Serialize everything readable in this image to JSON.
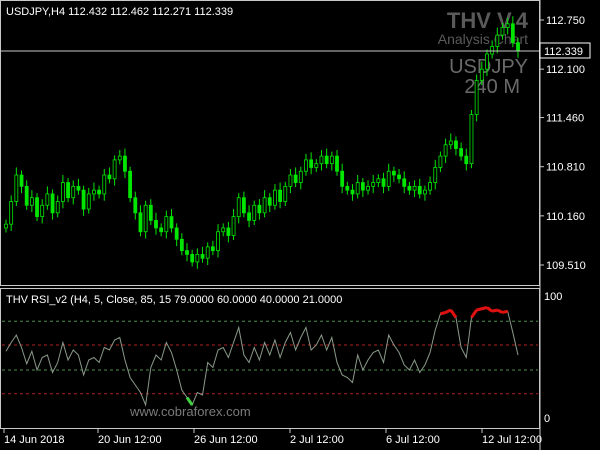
{
  "main_chart": {
    "symbol_info": "USDJPY,H4  112.432 112.462 112.271 112.339",
    "watermark_title": "THV V.4",
    "watermark_subtitle": "Analysis Chart",
    "watermark_symbol": "USDJPY",
    "watermark_timeframe": "240 M",
    "current_price": "112.339",
    "price_ticks": [
      "112.750",
      "112.100",
      "111.460",
      "110.810",
      "110.160",
      "109.510"
    ]
  },
  "indicator": {
    "label": "THV RSI_v2  (H4,  5,  Close,  85,  15 79.0000 60.0000 40.0000 21.0000",
    "scale_top": "100",
    "scale_bottom": "0",
    "levels": [
      79,
      60,
      40,
      21
    ],
    "level_colors": [
      "#4e8f4e",
      "#b02020",
      "#4e8f4e",
      "#b02020"
    ]
  },
  "time_axis": [
    "14 Jun 2018",
    "20 Jun 12:00",
    "26 Jun 12:00",
    "2 Jul 12:00",
    "6 Jul 12:00",
    "12 Jul 12:00"
  ],
  "footer": {
    "watermark": "www.cobraforex.com"
  },
  "colors": {
    "candle": "#00e600",
    "rsi_line": "#8a9a8a",
    "rsi_high": "#e01010",
    "rsi_low": "#40d040",
    "grid": "#c8c8c8"
  },
  "chart_data": {
    "type": "candlestick",
    "y_range": [
      109.3,
      112.95
    ],
    "rsi_range": [
      0,
      100
    ],
    "closes": [
      110.05,
      110.35,
      110.7,
      110.55,
      110.3,
      110.4,
      110.15,
      110.3,
      110.45,
      110.2,
      110.35,
      110.6,
      110.4,
      110.55,
      110.5,
      110.25,
      110.45,
      110.5,
      110.45,
      110.7,
      110.65,
      110.9,
      110.95,
      110.75,
      110.4,
      110.2,
      109.95,
      110.3,
      110.1,
      110.0,
      109.95,
      110.15,
      110.0,
      109.85,
      109.7,
      109.65,
      109.55,
      109.65,
      109.6,
      109.75,
      109.7,
      109.95,
      110.0,
      109.9,
      110.15,
      110.4,
      110.2,
      110.1,
      110.3,
      110.2,
      110.4,
      110.3,
      110.5,
      110.35,
      110.55,
      110.7,
      110.6,
      110.75,
      110.9,
      110.8,
      110.85,
      110.95,
      110.85,
      110.95,
      110.75,
      110.55,
      110.5,
      110.45,
      110.6,
      110.5,
      110.55,
      110.6,
      110.65,
      110.55,
      110.75,
      110.7,
      110.65,
      110.55,
      110.5,
      110.55,
      110.45,
      110.5,
      110.6,
      110.8,
      110.95,
      111.1,
      111.15,
      111.05,
      110.95,
      110.85,
      111.5,
      111.95,
      112.1,
      112.3,
      112.4,
      112.55,
      112.65,
      112.7,
      112.45,
      112.34
    ],
    "rsi": [
      55,
      62,
      68,
      58,
      45,
      55,
      40,
      50,
      52,
      38,
      46,
      62,
      48,
      56,
      52,
      36,
      48,
      50,
      46,
      58,
      56,
      64,
      66,
      48,
      34,
      28,
      22,
      12,
      42,
      52,
      48,
      62,
      54,
      40,
      24,
      18,
      12,
      22,
      20,
      46,
      42,
      56,
      58,
      50,
      62,
      74,
      52,
      46,
      58,
      48,
      62,
      52,
      64,
      50,
      62,
      70,
      56,
      66,
      74,
      56,
      60,
      68,
      56,
      66,
      46,
      36,
      34,
      30,
      52,
      40,
      48,
      54,
      56,
      46,
      68,
      60,
      54,
      44,
      40,
      48,
      38,
      44,
      54,
      72,
      85,
      86,
      88,
      82,
      58,
      50,
      82,
      88,
      89,
      90,
      87,
      88,
      86,
      87,
      70,
      52
    ]
  }
}
